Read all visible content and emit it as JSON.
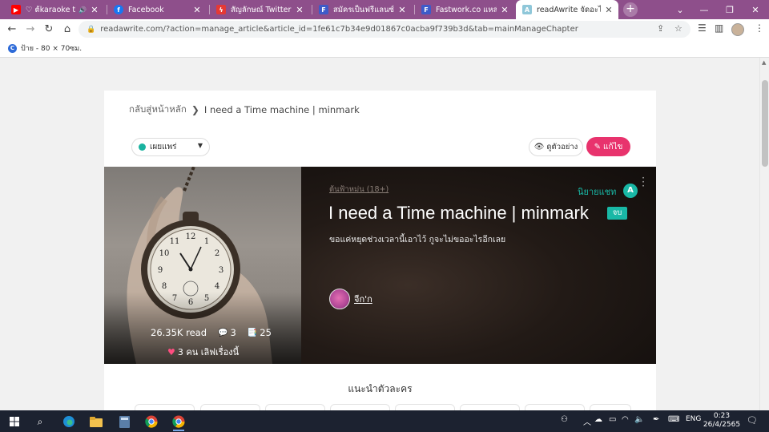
{
  "browser": {
    "tabs": [
      {
        "title": "♡ ต้karaoke thaisu",
        "icon": "youtube-icon",
        "sound": true
      },
      {
        "title": "Facebook",
        "icon": "facebook-icon"
      },
      {
        "title": "สัญลักษณ์ Twitter: อิ่ม E",
        "icon": "bolt-icon"
      },
      {
        "title": "สมัครเป็นฟรีแลนซ์ อิสระ",
        "icon": "fastwork-icon"
      },
      {
        "title": "Fastwork.co แหล่งรวมฟ",
        "icon": "fastwork-icon"
      },
      {
        "title": "readAwrite จัดอะไรให้ | อ",
        "icon": "readawrite-icon"
      }
    ],
    "url": "readawrite.com/?action=manage_article&article_id=1fe61c7b34e9d01867c0acba9f739b3d&tab=mainManageChapter",
    "bookmark_label": "ป้าย - 80 × 70ซม."
  },
  "page": {
    "breadcrumb_home": "กลับสู่หน้าหลัก",
    "breadcrumb_current": "I need a Time machine | minmark",
    "status_value": "เผยแพร่",
    "preview_label": "ดูตัวอย่าง",
    "edit_label": "แก้ไข",
    "hero": {
      "genre": "ต้นฟ้าหม่น (18+)",
      "type": "นิยายแชท",
      "type_badge": "A",
      "title": "I need a Time machine | minmark",
      "end_badge": "จบ",
      "description": "ขอแค่หยุดช่วงเวลานี้เอาไว้ กูจะไม่ขออะไรอีกเลย",
      "author": "จีก'ก",
      "reads": "26.35K read",
      "comments": "3",
      "chapters": "25",
      "likes": "3 คน เลิฟเรื่องนี้"
    },
    "section_heading": "แนะนำตัวละคร"
  },
  "taskbar": {
    "lang": "ENG",
    "time": "0:23",
    "date": "26/4/2565"
  },
  "colors": {
    "tab_strip": "#8e4f8b",
    "accent_pink": "#e8336d",
    "accent_teal": "#19b8a6",
    "status_dot": "#1ab3a0"
  }
}
